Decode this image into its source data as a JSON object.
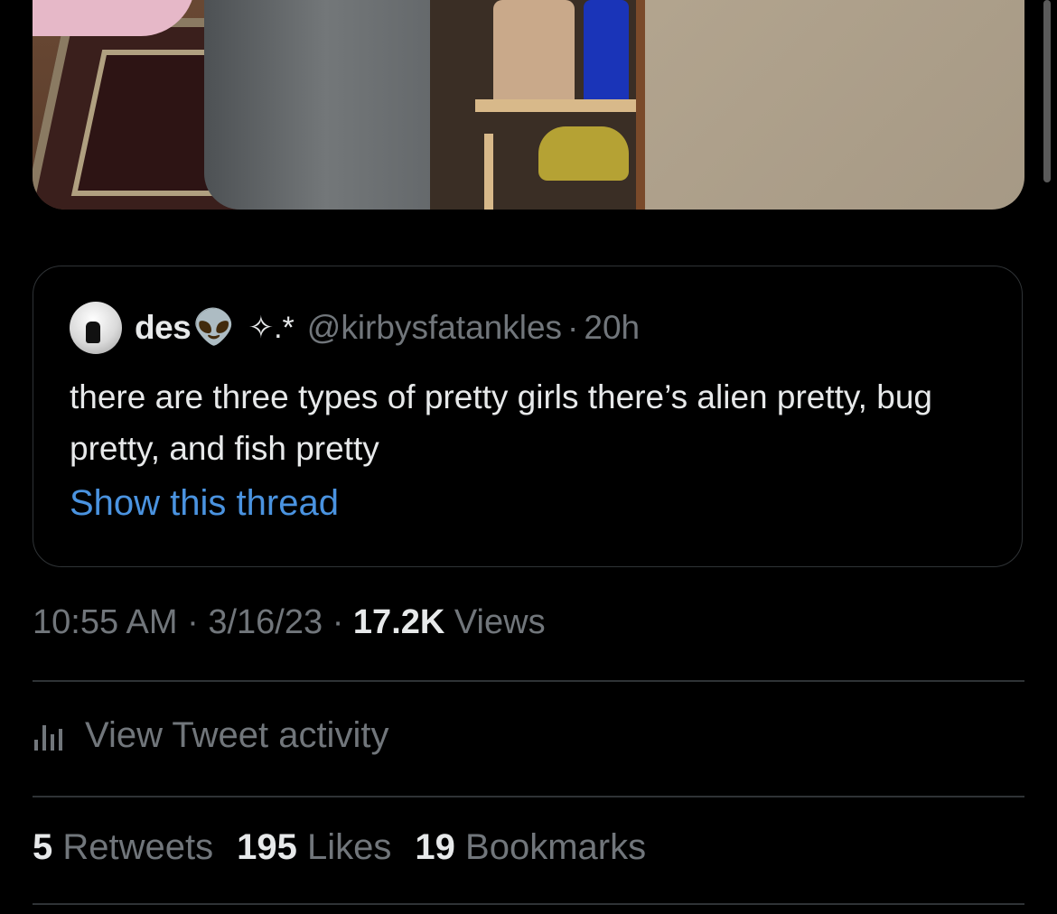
{
  "media": {
    "alt_icon": "photo"
  },
  "quote": {
    "display_name": "des",
    "name_emoji": "👽",
    "decoration": "✧.*",
    "handle": "@kirbysfatankles",
    "separator": "·",
    "time": "20h",
    "text": "there are three types of pretty girls there’s alien pretty, bug pretty, and fish pretty",
    "show_thread": "Show this thread"
  },
  "meta": {
    "time": "10:55 AM",
    "sep1": "·",
    "date": "3/16/23",
    "sep2": "·",
    "views_count": "17.2K",
    "views_label": "Views"
  },
  "activity": {
    "icon": "analytics-icon",
    "label": "View Tweet activity"
  },
  "stats": {
    "retweets_count": "5",
    "retweets_label": "Retweets",
    "likes_count": "195",
    "likes_label": "Likes",
    "bookmarks_count": "19",
    "bookmarks_label": "Bookmarks"
  },
  "colors": {
    "background": "#000000",
    "text": "#e7e9ea",
    "muted": "#71767b",
    "link": "#4a93e0",
    "border": "#2f3336"
  }
}
